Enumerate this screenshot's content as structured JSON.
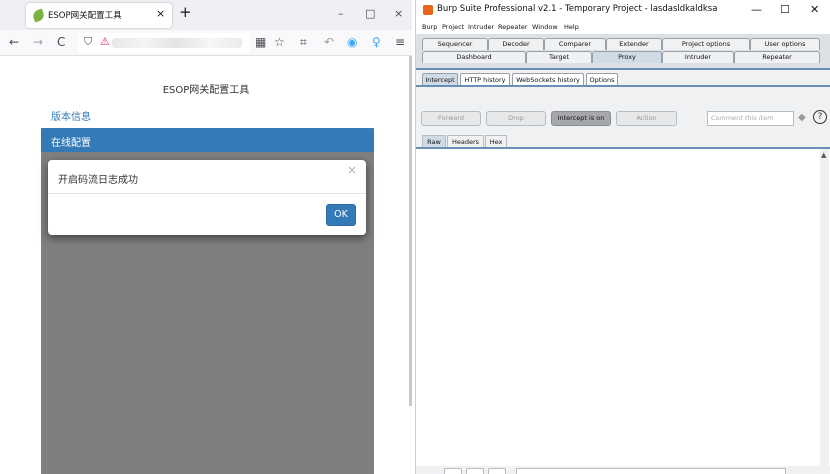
{
  "firefox": {
    "tab": {
      "title": "ESOP网关配置工具",
      "close": "×"
    },
    "new_tab": "+",
    "window_controls": {
      "minimize": "–",
      "maximize": "□",
      "close": "×"
    },
    "nav": {
      "back": "←",
      "forward": "→",
      "reload": "C",
      "shield": "⛉",
      "lock": "⚠"
    },
    "toolbar_icons": {
      "qr": "▦",
      "star": "☆",
      "crop": "⌗",
      "undo": "↶",
      "circle": "◉",
      "person": "♀",
      "menu": "≡"
    },
    "page": {
      "title": "ESOP网关配置工具",
      "version_link": "版本信息",
      "panel_heading": "在线配置",
      "modal": {
        "message": "开启码流日志成功",
        "close": "×",
        "ok": "OK"
      }
    }
  },
  "burp": {
    "title": "Burp Suite Professional v2.1 - Temporary Project - lasdasldkaldksa",
    "window_controls": {
      "minimize": "—",
      "maximize": "☐",
      "close": "✕"
    },
    "menu": [
      "Burp",
      "Project",
      "Intruder",
      "Repeater",
      "Window",
      "Help"
    ],
    "tabs_row1": [
      "Sequencer",
      "Decoder",
      "Comparer",
      "Extender",
      "Project options",
      "User options"
    ],
    "tabs_row2": [
      "Dashboard",
      "Target",
      "Proxy",
      "Intruder",
      "Repeater"
    ],
    "selected_tab": "Proxy",
    "subtabs": [
      "Intercept",
      "HTTP history",
      "WebSockets history",
      "Options"
    ],
    "selected_subtab": "Intercept",
    "buttons": {
      "forward": "Forward",
      "drop": "Drop",
      "intercept": "Intercept is on",
      "action": "Action"
    },
    "comment_placeholder": "Comment this item",
    "highlight_icon": "◆",
    "help_icon": "?",
    "request_tabs": [
      "Raw",
      "Headers",
      "Hex"
    ],
    "selected_request_tab": "Raw",
    "scroll_up_icon": "▲"
  }
}
